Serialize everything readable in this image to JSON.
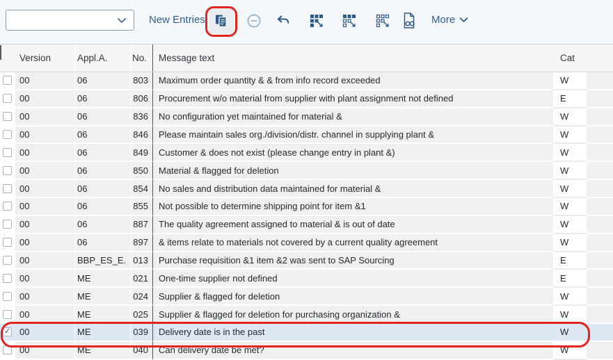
{
  "toolbar": {
    "combobox_value": "",
    "new_entries_label": "New Entries",
    "more_label": "More",
    "icons": [
      "copy-icon",
      "minus-circle-icon",
      "undo-icon",
      "select-all-icon",
      "select-block-icon",
      "deselect-all-icon",
      "display-icon",
      "chevron-down-icon"
    ]
  },
  "table": {
    "columns": [
      "Version",
      "Appl.A.",
      "No.",
      "Message text",
      "Cat"
    ],
    "checkbox_checked_glyph": "✓",
    "rows": [
      {
        "version": "00",
        "appl_area": "06",
        "no": "803",
        "message": "Maximum order quantity & & from info record exceeded",
        "cat": "W",
        "checked": false,
        "selected": false
      },
      {
        "version": "00",
        "appl_area": "06",
        "no": "806",
        "message": "Procurement w/o material from supplier with plant assignment not defined",
        "cat": "E",
        "checked": false,
        "selected": false
      },
      {
        "version": "00",
        "appl_area": "06",
        "no": "836",
        "message": "No configuration yet maintained for material &",
        "cat": "W",
        "checked": false,
        "selected": false
      },
      {
        "version": "00",
        "appl_area": "06",
        "no": "846",
        "message": "Please maintain sales org./division/distr. channel in supplying plant &",
        "cat": "W",
        "checked": false,
        "selected": false
      },
      {
        "version": "00",
        "appl_area": "06",
        "no": "849",
        "message": "Customer & does not exist (please change entry in plant &)",
        "cat": "W",
        "checked": false,
        "selected": false
      },
      {
        "version": "00",
        "appl_area": "06",
        "no": "850",
        "message": "Material & flagged for deletion",
        "cat": "W",
        "checked": false,
        "selected": false
      },
      {
        "version": "00",
        "appl_area": "06",
        "no": "854",
        "message": "No sales and distribution data maintained for material &",
        "cat": "W",
        "checked": false,
        "selected": false
      },
      {
        "version": "00",
        "appl_area": "06",
        "no": "855",
        "message": "Not possible to determine shipping point for item &1",
        "cat": "W",
        "checked": false,
        "selected": false
      },
      {
        "version": "00",
        "appl_area": "06",
        "no": "887",
        "message": "The quality agreement assigned to material & is out of date",
        "cat": "W",
        "checked": false,
        "selected": false
      },
      {
        "version": "00",
        "appl_area": "06",
        "no": "897",
        "message": "& items relate to materials not covered by a current quality agreement",
        "cat": "W",
        "checked": false,
        "selected": false
      },
      {
        "version": "00",
        "appl_area": "BBP_ES_E.",
        "no": "013",
        "message": "Purchase requisition &1 item &2 was sent to SAP Sourcing",
        "cat": "E",
        "checked": false,
        "selected": false
      },
      {
        "version": "00",
        "appl_area": "ME",
        "no": "021",
        "message": "One-time supplier not defined",
        "cat": "E",
        "checked": false,
        "selected": false
      },
      {
        "version": "00",
        "appl_area": "ME",
        "no": "024",
        "message": "Supplier & flagged for deletion",
        "cat": "W",
        "checked": false,
        "selected": false
      },
      {
        "version": "00",
        "appl_area": "ME",
        "no": "025",
        "message": "Supplier & flagged for deletion for purchasing organization &",
        "cat": "W",
        "checked": false,
        "selected": false
      },
      {
        "version": "00",
        "appl_area": "ME",
        "no": "039",
        "message": "Delivery date is in the past",
        "cat": "W",
        "checked": true,
        "selected": true
      },
      {
        "version": "00",
        "appl_area": "ME",
        "no": "040",
        "message": "Can delivery date be met?",
        "cat": "W",
        "checked": false,
        "selected": false
      }
    ]
  },
  "annotations": {
    "highlight_color": "#e0251f",
    "targets": [
      "copy-button",
      "row-me-039"
    ]
  },
  "colors": {
    "icon_blue": "#2e5a87",
    "link_blue": "#2e5d8c",
    "selected_row": "#dde8f4",
    "cell_gray": "#f0f0f0"
  }
}
